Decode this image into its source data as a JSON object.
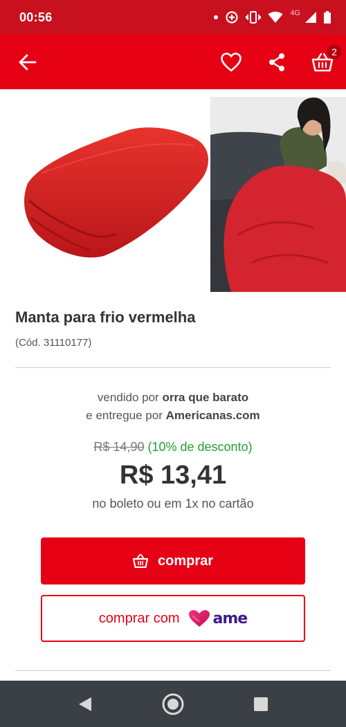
{
  "status_bar": {
    "time": "00:56",
    "network": "4G",
    "icons": [
      "notification-dot-icon",
      "data-saver-icon",
      "vibrate-icon",
      "wifi-icon",
      "signal-icon",
      "battery-icon"
    ]
  },
  "app_bar": {
    "icons": [
      "back-arrow-icon",
      "heart-icon",
      "share-icon",
      "cart-icon"
    ],
    "cart_count": "2"
  },
  "product": {
    "title": "Manta para frio vermelha",
    "code": "(Cód. 31110177)",
    "images": [
      "folded-red-blanket",
      "woman-on-sofa-with-red-blanket"
    ]
  },
  "seller": {
    "sold_by_prefix": "vendido por ",
    "sold_by_name": "orra que barato",
    "delivered_by_prefix": "e entregue por ",
    "delivered_by_name": "Americanas.com"
  },
  "price": {
    "old": "R$ 14,90",
    "discount": "(10% de desconto)",
    "current": "R$ 13,41",
    "payment_note": "no boleto ou em 1x no cartão"
  },
  "actions": {
    "buy_label": "comprar",
    "buy_with_label": "comprar com",
    "ame_brand": "ame"
  },
  "colors": {
    "brand_red": "#e60014",
    "status_red": "#c8101f",
    "discount_green": "#23a133",
    "ame_purple": "#3b1a8c",
    "ame_pink": "#e4146b"
  },
  "nav_bar": {
    "icons": [
      "nav-back-icon",
      "nav-home-icon",
      "nav-recents-icon"
    ]
  }
}
